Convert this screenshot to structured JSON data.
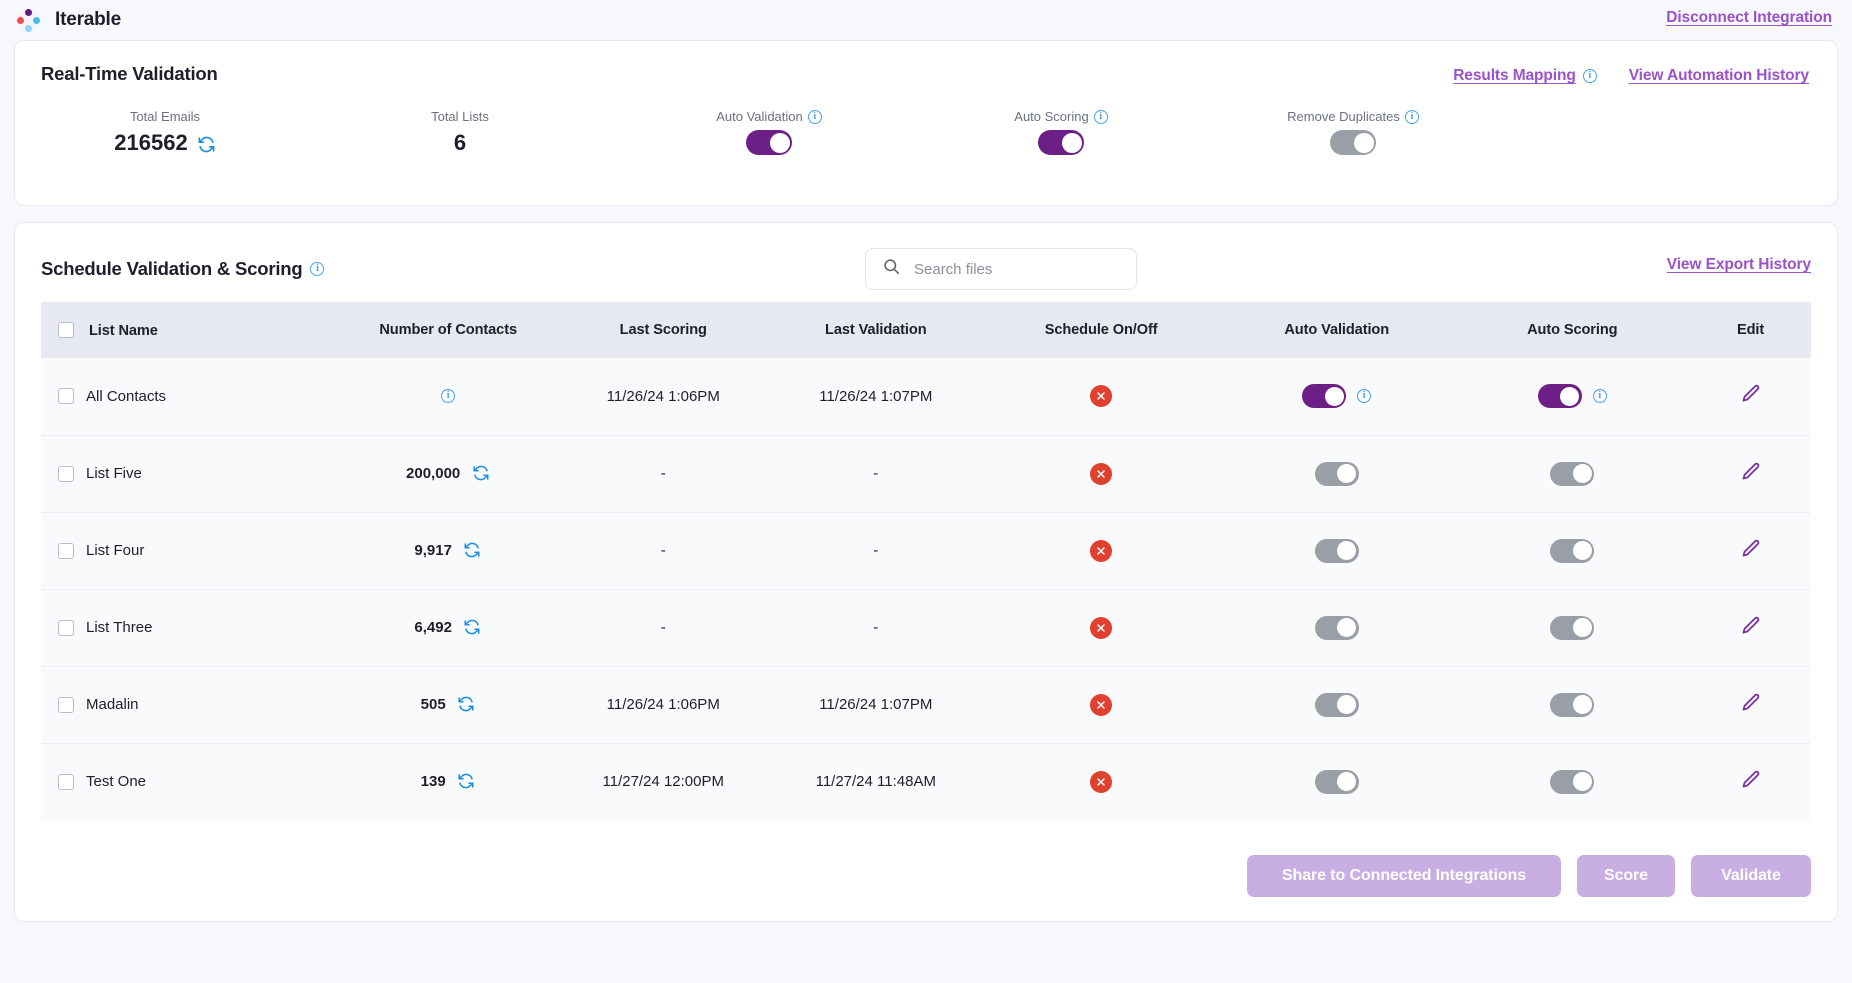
{
  "topbar": {
    "brand_name": "Iterable",
    "logo_icon": "iterable-diamond-logo",
    "disconnect_label": "Disconnect Integration"
  },
  "realtime": {
    "title": "Real-Time Validation",
    "results_mapping_label": "Results Mapping",
    "automation_history_label": "View Automation History",
    "stats": [
      {
        "label": "Total Emails",
        "value": "216562",
        "has_sync": true
      },
      {
        "label": "Total Lists",
        "value": "6",
        "has_sync": false
      }
    ],
    "toggles": [
      {
        "label": "Auto Validation",
        "state": "on"
      },
      {
        "label": "Auto Scoring",
        "state": "on"
      },
      {
        "label": "Remove Duplicates",
        "state": "off"
      }
    ]
  },
  "schedule": {
    "title": "Schedule Validation & Scoring",
    "search_placeholder": "Search files",
    "search_value": "",
    "export_history_label": "View Export History",
    "columns": [
      "List Name",
      "Number of Contacts",
      "Last Scoring",
      "Last Validation",
      "Schedule On/Off",
      "Auto Validation",
      "Auto Scoring",
      "Edit"
    ],
    "rows": [
      {
        "name": "All Contacts",
        "contacts": "",
        "contacts_info": true,
        "contacts_sync": false,
        "last_scoring": "11/26/24 1:06PM",
        "last_validation": "11/26/24 1:07PM",
        "schedule": "off",
        "auto_validation": "on",
        "auto_validation_info": true,
        "auto_scoring": "on",
        "auto_scoring_info": true
      },
      {
        "name": "List Five",
        "contacts": "200,000",
        "contacts_info": false,
        "contacts_sync": true,
        "last_scoring": "-",
        "last_validation": "-",
        "schedule": "off",
        "auto_validation": "off",
        "auto_validation_info": false,
        "auto_scoring": "off",
        "auto_scoring_info": false
      },
      {
        "name": "List Four",
        "contacts": "9,917",
        "contacts_info": false,
        "contacts_sync": true,
        "last_scoring": "-",
        "last_validation": "-",
        "schedule": "off",
        "auto_validation": "off",
        "auto_validation_info": false,
        "auto_scoring": "off",
        "auto_scoring_info": false
      },
      {
        "name": "List Three",
        "contacts": "6,492",
        "contacts_info": false,
        "contacts_sync": true,
        "last_scoring": "-",
        "last_validation": "-",
        "schedule": "off",
        "auto_validation": "off",
        "auto_validation_info": false,
        "auto_scoring": "off",
        "auto_scoring_info": false
      },
      {
        "name": "Madalin",
        "contacts": "505",
        "contacts_info": false,
        "contacts_sync": true,
        "last_scoring": "11/26/24 1:06PM",
        "last_validation": "11/26/24 1:07PM",
        "schedule": "off",
        "auto_validation": "off",
        "auto_validation_info": false,
        "auto_scoring": "off",
        "auto_scoring_info": false
      },
      {
        "name": "Test One",
        "contacts": "139",
        "contacts_info": false,
        "contacts_sync": true,
        "last_scoring": "11/27/24 12:00PM",
        "last_validation": "11/27/24 11:48AM",
        "schedule": "off",
        "auto_validation": "off",
        "auto_validation_info": false,
        "auto_scoring": "off",
        "auto_scoring_info": false
      }
    ],
    "actions": [
      {
        "label": "Share to Connected Integrations",
        "size": "wide",
        "disabled": true
      },
      {
        "label": "Score",
        "size": "small",
        "disabled": true
      },
      {
        "label": "Validate",
        "size": "med",
        "disabled": true
      }
    ]
  },
  "icons": {
    "info": "info-icon",
    "sync": "sync-icon",
    "search": "search-icon",
    "edit": "pencil-icon",
    "schedule_off": "circle-x-icon"
  },
  "colors": {
    "accent_purple": "#9b51c9",
    "toggle_on": "#6b1f87",
    "toggle_off": "#9a9ea6",
    "danger_red": "#e0402e",
    "info_blue": "#4aa3e8",
    "page_bg": "#f7f8fc",
    "header_row_bg": "#e6e9f1",
    "button_disabled": "#c9aee4"
  }
}
